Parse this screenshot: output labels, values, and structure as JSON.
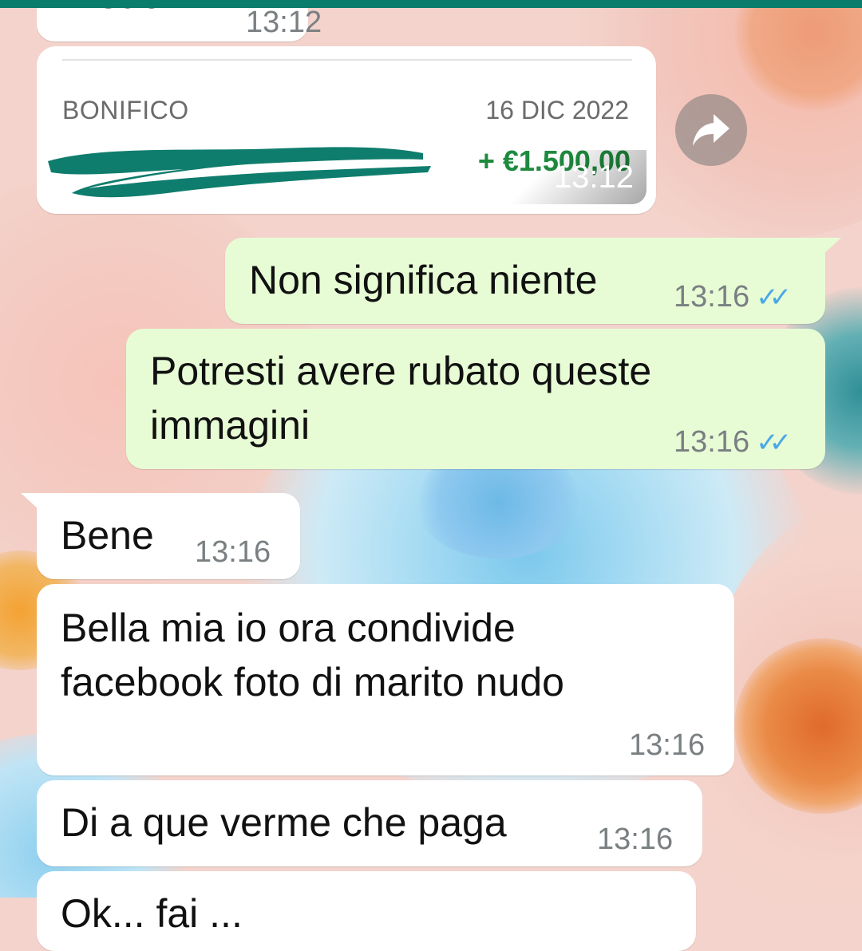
{
  "prev_message": {
    "text": "E suo",
    "time": "13:12"
  },
  "bank_card": {
    "label": "BONIFICO",
    "date": "16 DIC 2022",
    "amount": "+ €1.500,00",
    "time": "13:12",
    "redaction_color": "#0f7d6d"
  },
  "messages": [
    {
      "dir": "out",
      "text": "Non significa niente",
      "time": "13:16",
      "status": "read"
    },
    {
      "dir": "out",
      "text_line1": "Potresti avere rubato queste",
      "text_line2": "immagini",
      "time": "13:16",
      "status": "read"
    },
    {
      "dir": "in",
      "text": "Bene",
      "time": "13:16"
    },
    {
      "dir": "in",
      "text_line1": "Bella mia io ora condivide",
      "text_line2": "facebook foto di marito nudo",
      "time": "13:16"
    },
    {
      "dir": "in",
      "text": "Di a que verme che paga",
      "time": "13:16"
    },
    {
      "dir": "in",
      "text": "Ok... fai ...",
      "time": ""
    }
  ],
  "forward_icon": "forward-arrow-icon",
  "colors": {
    "header": "#0b7d6b",
    "outgoing_bubble": "#e7fcd5",
    "incoming_bubble": "#ffffff",
    "read_ticks": "#4aa8e6",
    "amount_green": "#1e8a3e"
  }
}
